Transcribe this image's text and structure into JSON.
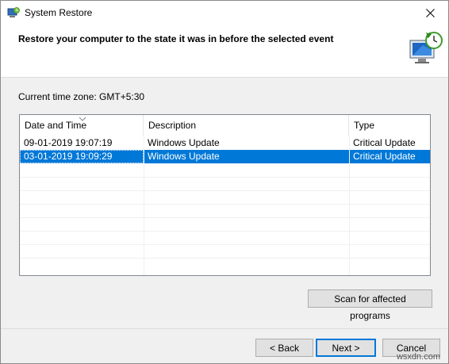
{
  "window": {
    "title": "System Restore"
  },
  "header": {
    "text": "Restore your computer to the state it was in before the selected event"
  },
  "timezone": {
    "label": "Current time zone: GMT+5:30"
  },
  "table": {
    "columns": [
      "Date and Time",
      "Description",
      "Type"
    ],
    "rows": [
      {
        "date": "09-01-2019 19:07:19",
        "description": "Windows Update",
        "type": "Critical Update",
        "selected": false
      },
      {
        "date": "03-01-2019 19:09:29",
        "description": "Windows Update",
        "type": "Critical Update",
        "selected": true
      }
    ]
  },
  "buttons": {
    "scan": "Scan for affected programs",
    "back": "< Back",
    "next": "Next >",
    "cancel": "Cancel"
  },
  "watermark": "wsxdn.com",
  "colors": {
    "selection": "#0078d7",
    "dialog_bg": "#f0f0f0",
    "header_bg": "#ffffff"
  },
  "icons": [
    "system-restore-icon",
    "close-icon",
    "sort-arrow-icon",
    "restore-computer-icon"
  ]
}
